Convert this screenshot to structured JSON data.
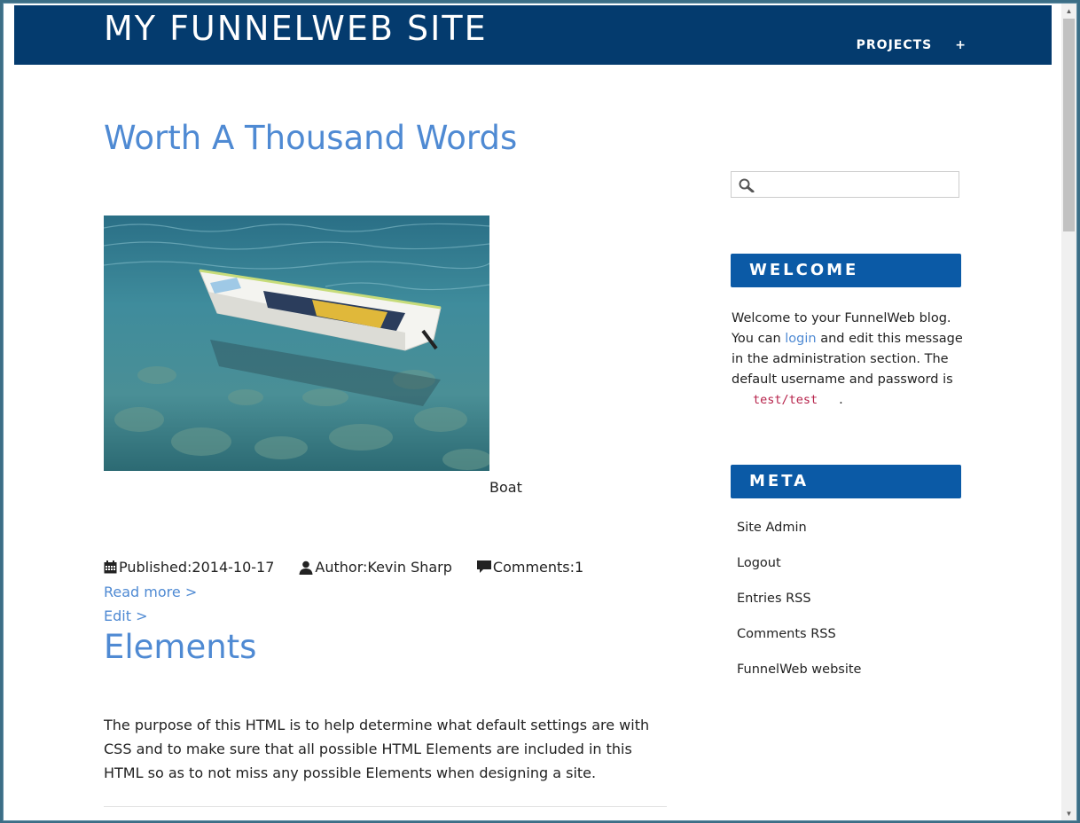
{
  "header": {
    "site_title": "MY FUNNELWEB SITE",
    "nav": [
      {
        "label": "PROJECTS"
      },
      {
        "label": "+"
      }
    ]
  },
  "posts": [
    {
      "title": "Worth A Thousand Words",
      "image_caption": "Boat",
      "published_label": "Published:",
      "published_value": "2014-10-17",
      "author_label": "Author:",
      "author_value": "Kevin Sharp",
      "comments_label": "Comments:",
      "comments_value": "1",
      "read_more": "Read more >",
      "edit": "Edit >"
    },
    {
      "title": "Elements",
      "excerpt": "The purpose of this HTML is to help determine what default settings are with CSS and to make sure that all possible HTML Elements are included in this HTML so as to not miss any possible Elements when designing a site."
    }
  ],
  "sidebar": {
    "search": {
      "placeholder": "",
      "value": ""
    },
    "welcome": {
      "title": "WELCOME",
      "text_before": "Welcome to your FunnelWeb blog. You can ",
      "login_link": "login",
      "text_after": " and edit this message in the administration section. The default username and password is ",
      "code": "test/test",
      "text_end": "."
    },
    "meta": {
      "title": "META",
      "links": [
        "Site Admin",
        "Logout",
        "Entries RSS",
        "Comments RSS",
        "FunnelWeb website"
      ]
    }
  },
  "colors": {
    "header_bg": "#043b6e",
    "widget_bg": "#0b5aa6",
    "link": "#4f8ad3",
    "code": "#b6224a"
  },
  "icons": [
    "search-icon",
    "calendar-icon",
    "user-icon",
    "comment-icon",
    "scroll-up-arrow",
    "scroll-down-arrow"
  ]
}
